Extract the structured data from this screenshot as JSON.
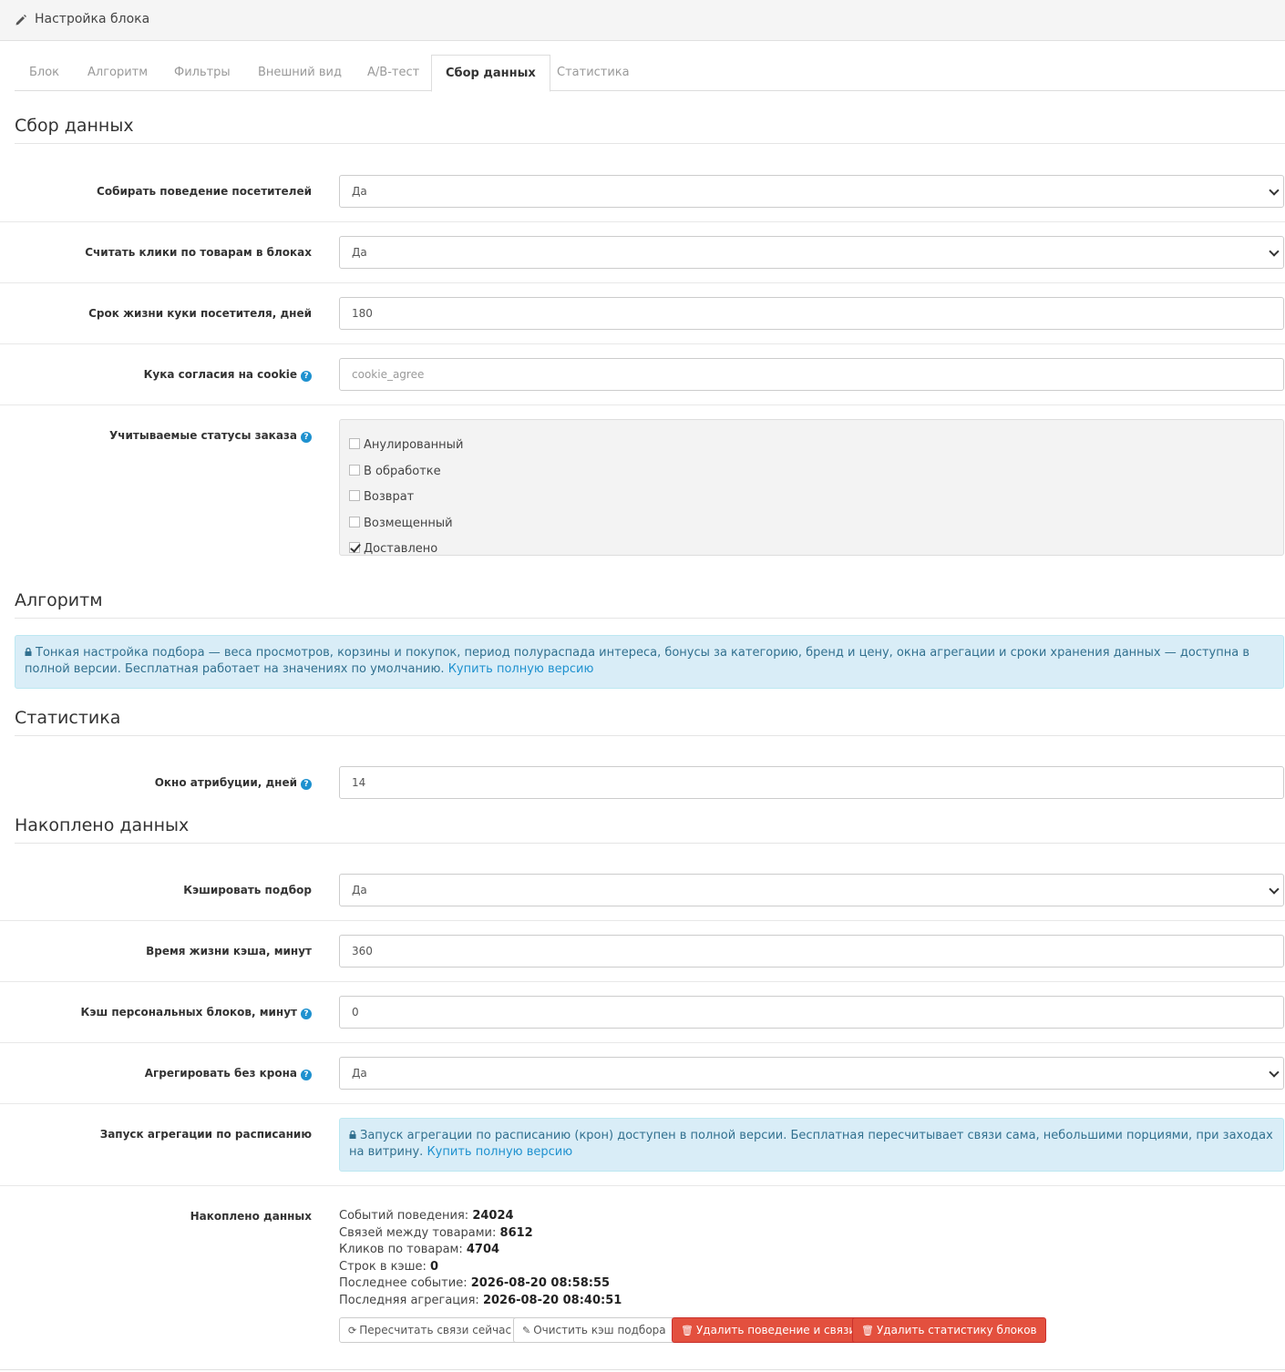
{
  "panel": {
    "title": "Настройка блока"
  },
  "tabs": [
    {
      "label": "Блок"
    },
    {
      "label": "Алгоритм"
    },
    {
      "label": "Фильтры"
    },
    {
      "label": "Внешний вид"
    },
    {
      "label": "A/B-тест"
    },
    {
      "label": "Сбор данных",
      "active": true
    },
    {
      "label": "Статистика"
    }
  ],
  "sections": {
    "data_collection": "Сбор данных",
    "algorithm": "Алгоритм",
    "statistics": "Статистика",
    "accumulated": "Накоплено данных"
  },
  "fields": {
    "collect_behavior": {
      "label": "Собирать поведение посетителей",
      "value": "Да"
    },
    "count_clicks": {
      "label": "Считать клики по товарам в блоках",
      "value": "Да"
    },
    "cookie_lifetime": {
      "label": "Срок жизни куки посетителя, дней",
      "value": "180"
    },
    "consent_cookie": {
      "label": "Кука согласия на cookie",
      "placeholder": "cookie_agree"
    },
    "order_statuses": {
      "label": "Учитываемые статусы заказа",
      "options": [
        {
          "label": "Анулированный",
          "checked": false
        },
        {
          "label": "В обработке",
          "checked": false
        },
        {
          "label": "Возврат",
          "checked": false
        },
        {
          "label": "Возмещенный",
          "checked": false
        },
        {
          "label": "Доставлено",
          "checked": true
        }
      ]
    },
    "attribution_window": {
      "label": "Окно атрибуции, дней",
      "value": "14"
    },
    "cache_selection": {
      "label": "Кэшировать подбор",
      "value": "Да"
    },
    "cache_lifetime": {
      "label": "Время жизни кэша, минут",
      "value": "360"
    },
    "personal_cache": {
      "label": "Кэш персональных блоков, минут",
      "value": "0"
    },
    "aggregate_no_cron": {
      "label": "Агрегировать без крона",
      "value": "Да"
    },
    "scheduled_aggregation": {
      "label": "Запуск агрегации по расписанию"
    },
    "accumulated_data": {
      "label": "Накоплено данных"
    }
  },
  "alerts": {
    "algorithm": {
      "text": "Тонкая настройка подбора — веса просмотров, корзины и покупок, период полураспада интереса, бонусы за категорию, бренд и цену, окна агрегации и сроки хранения данных — доступна в полной версии. Бесплатная работает на значениях по умолчанию.",
      "link": "Купить полную версию"
    },
    "schedule": {
      "text": "Запуск агрегации по расписанию (крон) доступен в полной версии. Бесплатная пересчитывает связи сама, небольшими порциями, при заходах на витрину.",
      "link": "Купить полную версию"
    }
  },
  "stats": [
    {
      "label": "Событий поведения:",
      "value": "24024"
    },
    {
      "label": "Связей между товарами:",
      "value": "8612"
    },
    {
      "label": "Кликов по товарам:",
      "value": "4704"
    },
    {
      "label": "Строк в кэше:",
      "value": "0"
    },
    {
      "label": "Последнее событие:",
      "value": "2026-08-20 08:58:55"
    },
    {
      "label": "Последняя агрегация:",
      "value": "2026-08-20 08:40:51"
    }
  ],
  "buttons": {
    "recalc": "Пересчитать связи сейчас",
    "clear_cache": "Очистить кэш подбора",
    "delete_behavior": "Удалить поведение и связи",
    "delete_stats": "Удалить статистику блоков"
  },
  "icons": {
    "pencil": "pencil-icon",
    "help": "question-circle-icon",
    "lock": "lock-icon",
    "refresh": "refresh-icon",
    "eraser": "eraser-icon",
    "trash": "trash-icon"
  },
  "colors": {
    "link": "#1e91cf",
    "help": "#1e91cf",
    "danger": "#e3503e",
    "alert_bg": "#d9edf7",
    "alert_text": "#31708f"
  }
}
